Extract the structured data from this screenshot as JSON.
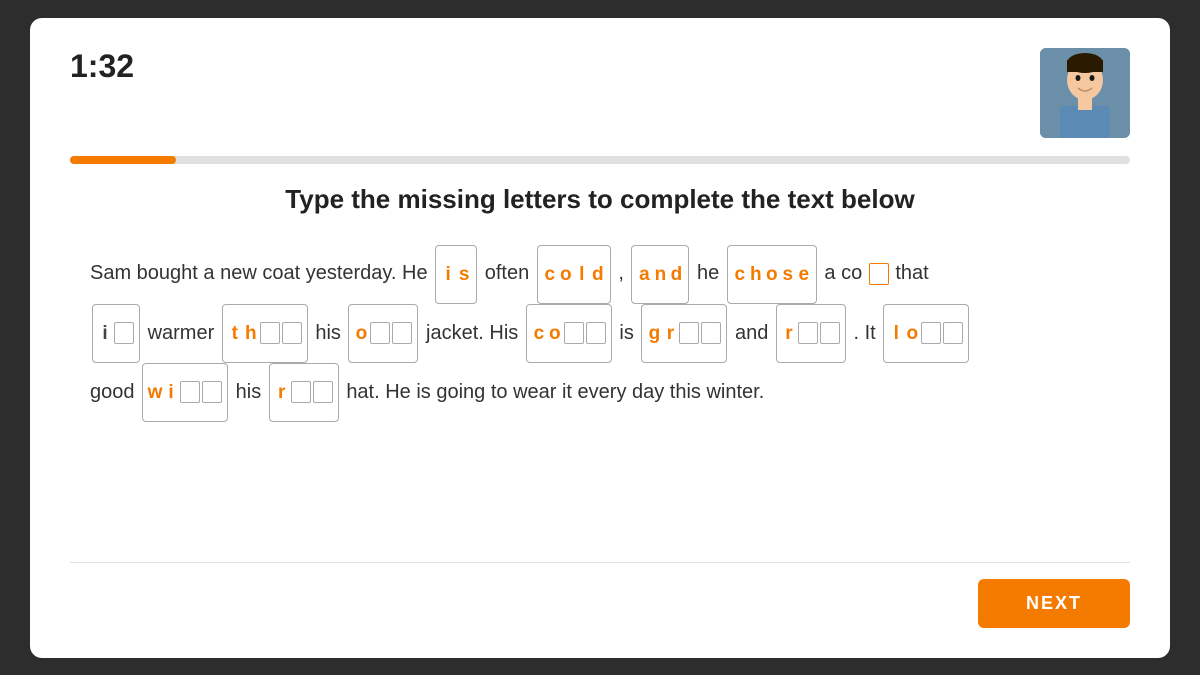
{
  "timer": "1:32",
  "progress": 10,
  "instruction": "Type the missing letters to complete the text below",
  "next_button": "NEXT",
  "sentences": [
    {
      "id": "s1",
      "parts": [
        {
          "type": "text",
          "value": "Sam bought a new coat yesterday. He "
        },
        {
          "type": "box",
          "letters": [
            {
              "ch": "i",
              "style": "orange"
            },
            {
              "ch": "s",
              "style": "orange"
            }
          ],
          "blanks": 0
        },
        {
          "type": "text",
          "value": " often "
        },
        {
          "type": "box",
          "letters": [
            {
              "ch": "c",
              "style": "orange"
            },
            {
              "ch": "o",
              "style": "orange"
            },
            {
              "ch": "l",
              "style": "orange"
            },
            {
              "ch": "d",
              "style": "orange"
            }
          ],
          "blanks": 0
        },
        {
          "type": "text",
          "value": ", "
        },
        {
          "type": "box",
          "letters": [
            {
              "ch": "a",
              "style": "orange"
            },
            {
              "ch": "n",
              "style": "orange"
            },
            {
              "ch": "d",
              "style": "orange"
            }
          ],
          "blanks": 0
        },
        {
          "type": "text",
          "value": " he "
        },
        {
          "type": "box",
          "letters": [
            {
              "ch": "c",
              "style": "orange"
            },
            {
              "ch": "h",
              "style": "orange"
            },
            {
              "ch": "o",
              "style": "orange"
            },
            {
              "ch": "s",
              "style": "orange"
            },
            {
              "ch": "e",
              "style": "orange"
            }
          ],
          "blanks": 0
        },
        {
          "type": "text",
          "value": " a co"
        },
        {
          "type": "box-partial",
          "letters": [],
          "blanks": 1,
          "blank_style": "orange"
        },
        {
          "type": "text",
          "value": " that"
        }
      ]
    },
    {
      "id": "s2",
      "parts": [
        {
          "type": "box-partial",
          "letters": [
            {
              "ch": "i",
              "style": "normal"
            }
          ],
          "blanks": 1,
          "blank_style": "gray"
        },
        {
          "type": "text",
          "value": " warmer "
        },
        {
          "type": "box-partial",
          "letters": [
            {
              "ch": "t",
              "style": "orange"
            },
            {
              "ch": "h",
              "style": "orange"
            }
          ],
          "blanks": 2,
          "blank_style": "gray"
        },
        {
          "type": "text",
          "value": " his "
        },
        {
          "type": "box-partial",
          "letters": [
            {
              "ch": "o",
              "style": "orange"
            }
          ],
          "blanks": 2,
          "blank_style": "gray"
        },
        {
          "type": "text",
          "value": " jacket. His "
        },
        {
          "type": "box-partial",
          "letters": [
            {
              "ch": "c",
              "style": "orange"
            },
            {
              "ch": "o",
              "style": "orange"
            }
          ],
          "blanks": 2,
          "blank_style": "gray"
        },
        {
          "type": "text",
          "value": " is "
        },
        {
          "type": "box-partial",
          "letters": [
            {
              "ch": "g",
              "style": "orange"
            },
            {
              "ch": "r",
              "style": "orange"
            }
          ],
          "blanks": 2,
          "blank_style": "gray"
        },
        {
          "type": "text",
          "value": " and "
        },
        {
          "type": "box-partial",
          "letters": [
            {
              "ch": "r",
              "style": "orange"
            }
          ],
          "blanks": 2,
          "blank_style": "gray"
        },
        {
          "type": "text",
          "value": ". It "
        },
        {
          "type": "box-partial",
          "letters": [
            {
              "ch": "l",
              "style": "orange"
            },
            {
              "ch": "o",
              "style": "orange"
            }
          ],
          "blanks": 2,
          "blank_style": "gray"
        }
      ]
    },
    {
      "id": "s3",
      "parts": [
        {
          "type": "text",
          "value": "good "
        },
        {
          "type": "box-partial",
          "letters": [
            {
              "ch": "w",
              "style": "orange"
            },
            {
              "ch": "i",
              "style": "orange"
            }
          ],
          "blanks": 2,
          "blank_style": "gray"
        },
        {
          "type": "text",
          "value": " his "
        },
        {
          "type": "box-partial",
          "letters": [
            {
              "ch": "r",
              "style": "orange"
            }
          ],
          "blanks": 2,
          "blank_style": "gray"
        },
        {
          "type": "text",
          "value": " hat. He is going to wear it every day this winter."
        }
      ]
    }
  ]
}
